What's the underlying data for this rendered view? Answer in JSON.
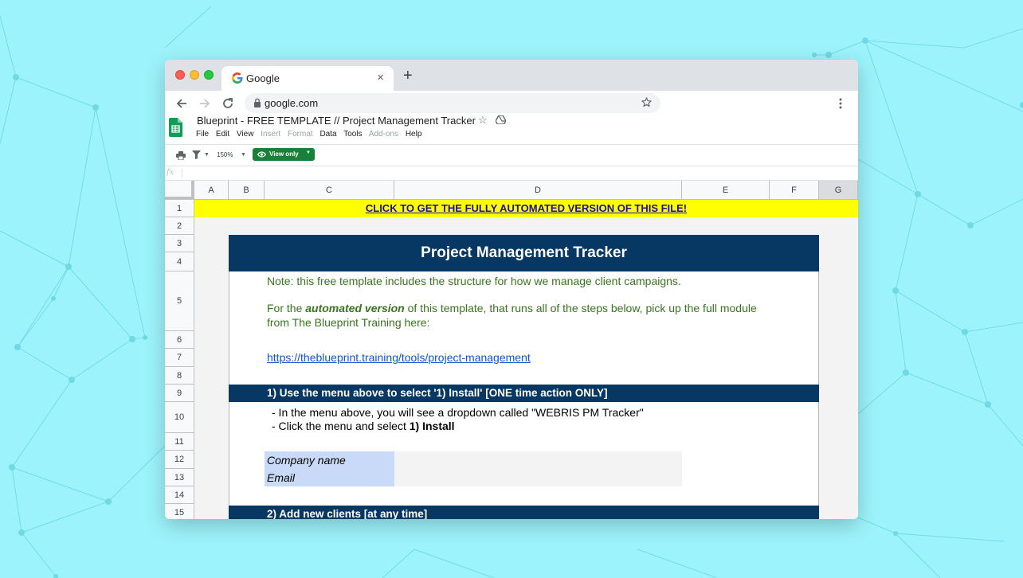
{
  "browser": {
    "tab_title": "Google",
    "tab_close": "×",
    "new_tab": "+",
    "url": "google.com"
  },
  "sheet": {
    "doc_title": "Blueprint - FREE TEMPLATE // Project Management Tracker",
    "star": "☆",
    "menu": [
      "File",
      "Edit",
      "View",
      "Insert",
      "Format",
      "Data",
      "Tools",
      "Add-ons",
      "Help"
    ],
    "menu_disabled": [
      "Insert",
      "Format",
      "Add-ons"
    ],
    "zoom": "150%",
    "view_only": "View only",
    "fx": "fx",
    "columns": [
      "A",
      "B",
      "C",
      "D",
      "E",
      "F",
      "G"
    ],
    "rows": [
      "1",
      "2",
      "3",
      "4",
      "5",
      "6",
      "7",
      "8",
      "9",
      "10",
      "11",
      "12",
      "13",
      "14",
      "15"
    ]
  },
  "content": {
    "banner": "CLICK TO GET THE FULLY AUTOMATED VERSION OF THIS FILE!",
    "title": "Project Management Tracker",
    "note": "Note: this free template includes the structure for how we manage client campaigns.",
    "automated_pre": "For the ",
    "automated_em": "automated version",
    "automated_post": " of this template, that runs all of the steps below, pick up the full module",
    "automated_line2": "from The Blueprint Training here:",
    "link": "https://theblueprint.training/tools/project-management",
    "section1": "1) Use the menu above to select '1) Install' [ONE time action ONLY]",
    "instr1": " - In the menu above, you will see a dropdown called \"WEBRIS PM Tracker\"",
    "instr2_pre": " - Click the menu and select ",
    "instr2_bold": "1) Install",
    "company_label": "Company name",
    "email_label": "Email",
    "section2": "2) Add new clients [at any time]"
  },
  "colors": {
    "background": "#9df3fb",
    "banner": "#ffff00",
    "header_navy": "#073763",
    "note_green": "#38761d",
    "label_blue": "#c9daf8",
    "view_only_green": "#188038"
  }
}
